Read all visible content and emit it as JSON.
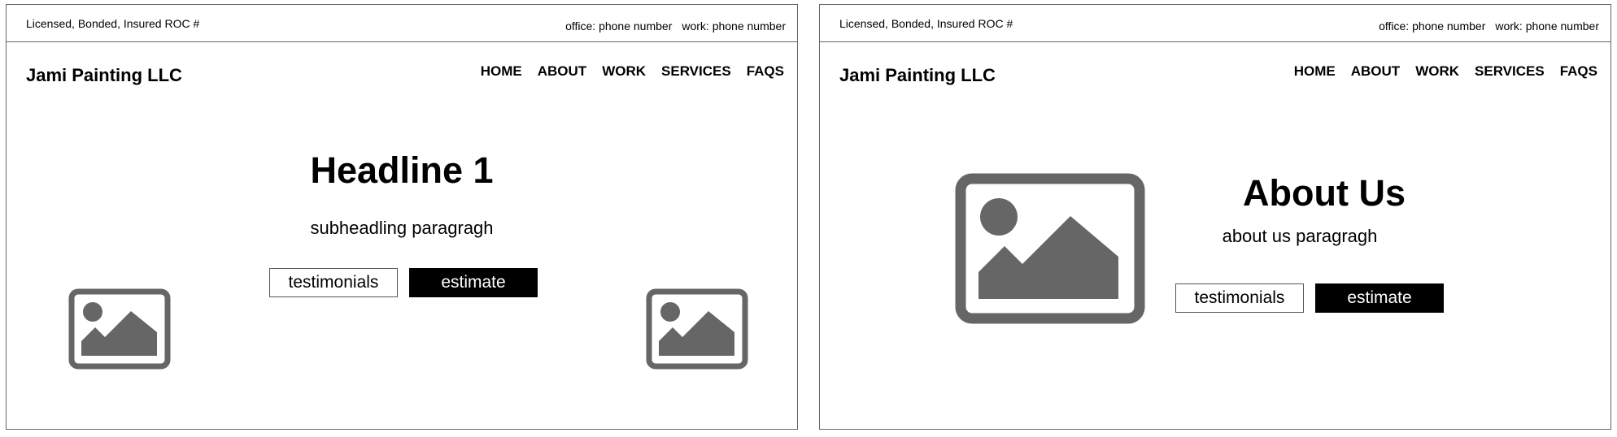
{
  "left": {
    "topbar": {
      "license": "Licensed, Bonded, Insured ROC #",
      "office": "office: phone number",
      "work": "work: phone number"
    },
    "logo": "Jami Painting LLC",
    "nav": [
      "HOME",
      "ABOUT",
      "WORK",
      "SERVICES",
      "FAQS"
    ],
    "headline": "Headline 1",
    "subheading": "subheadling paragragh",
    "buttons": {
      "testimonials": "testimonials",
      "estimate": "estimate"
    }
  },
  "right": {
    "topbar": {
      "license": "Licensed, Bonded, Insured ROC #",
      "office": "office: phone number",
      "work": "work: phone number"
    },
    "logo": "Jami Painting LLC",
    "nav": [
      "HOME",
      "ABOUT",
      "WORK",
      "SERVICES",
      "FAQS"
    ],
    "title": "About Us",
    "paragraph": "about us paragragh",
    "buttons": {
      "testimonials": "testimonials",
      "estimate": "estimate"
    }
  },
  "icons": {
    "image_placeholder": "image-placeholder-icon"
  },
  "colors": {
    "placeholder_gray": "#666666",
    "button_dark": "#000000",
    "border": "#666666"
  }
}
